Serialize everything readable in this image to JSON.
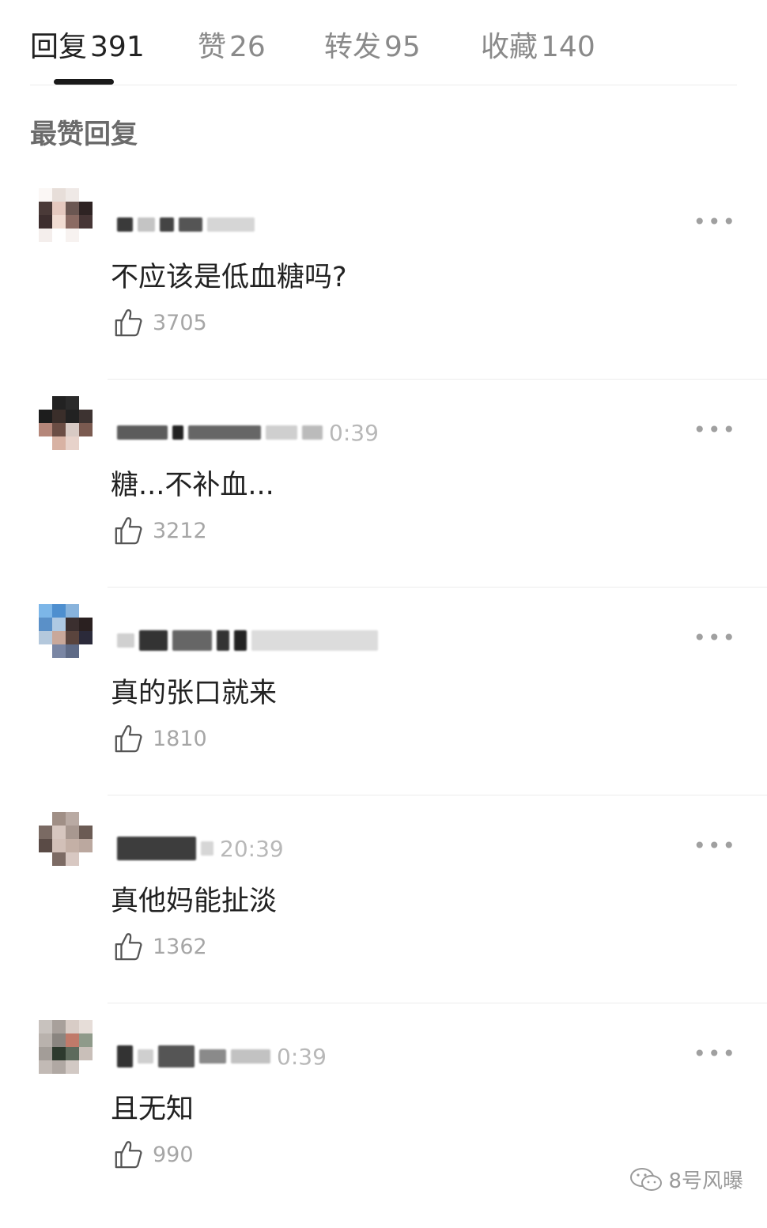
{
  "tabs": [
    {
      "label": "回复",
      "count": "391"
    },
    {
      "label": "赞",
      "count": "26"
    },
    {
      "label": "转发",
      "count": "95"
    },
    {
      "label": "收藏",
      "count": "140"
    }
  ],
  "section_title": "最赞回复",
  "comments": [
    {
      "time": "",
      "text": "不应该是低血糖吗?",
      "likes": "3705"
    },
    {
      "time": "0:39",
      "text": "糖...不补血...",
      "likes": "3212"
    },
    {
      "time": "",
      "text": "真的张口就来",
      "likes": "1810"
    },
    {
      "time": "20:39",
      "text": "真他妈能扯淡",
      "likes": "1362"
    },
    {
      "time": "0:39",
      "text": "且无知",
      "likes": "990"
    }
  ],
  "more_label": "•••",
  "watermark": {
    "text": "8号风曝",
    "icon": "wechat-icon"
  },
  "colors": {
    "active_tab": "#222222",
    "inactive_tab": "#8a8a8a",
    "like_count": "#a6a6a6"
  }
}
